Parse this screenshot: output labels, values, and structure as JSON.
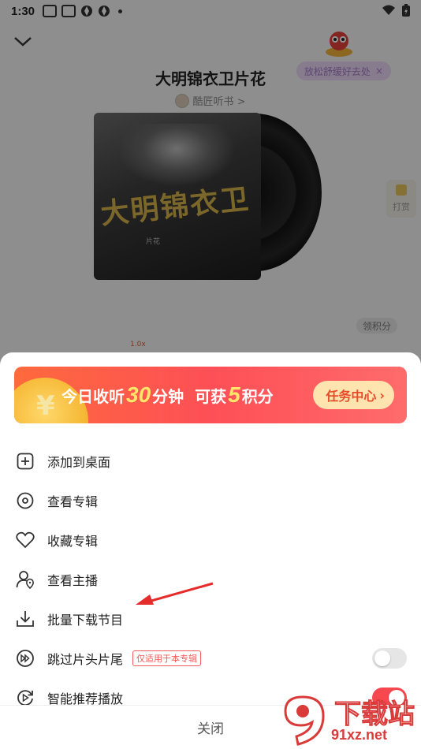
{
  "status_bar": {
    "time": "1:30"
  },
  "player": {
    "title": "大明锦衣卫片花",
    "author": "酷匠听书 >",
    "relax_pill": "放松舒缓好去处",
    "relax_close": "×",
    "cover_text": "大明锦衣卫",
    "cover_subtitle": "片花",
    "tip_label": "打赏",
    "points_badge": "领积分",
    "speed_badge": "1.0x"
  },
  "banner": {
    "prefix": "今日收听",
    "minutes": "30",
    "mid": "分钟",
    "gain": "可获",
    "points": "5",
    "suffix": "积分",
    "task_button": "任务中心",
    "task_chevron": "›"
  },
  "menu": {
    "items": [
      {
        "label": "添加到桌面",
        "icon": "add-square-icon"
      },
      {
        "label": "查看专辑",
        "icon": "disc-icon"
      },
      {
        "label": "收藏专辑",
        "icon": "heart-icon"
      },
      {
        "label": "查看主播",
        "icon": "user-location-icon"
      },
      {
        "label": "批量下载节目",
        "icon": "download-icon"
      },
      {
        "label": "跳过片头片尾",
        "icon": "skip-icon",
        "tag": "仅适用于本专辑",
        "toggle": "off"
      },
      {
        "label": "智能推荐播放",
        "icon": "smart-play-icon",
        "toggle": "on"
      }
    ]
  },
  "close_label": "关闭",
  "watermark": {
    "text": "下载站",
    "url": "91xz.net"
  },
  "colors": {
    "accent": "#f7474f",
    "banner_start": "#ff6a3d",
    "banner_end": "#ff6b6b",
    "task_btn_bg": "#ffe4b0"
  }
}
